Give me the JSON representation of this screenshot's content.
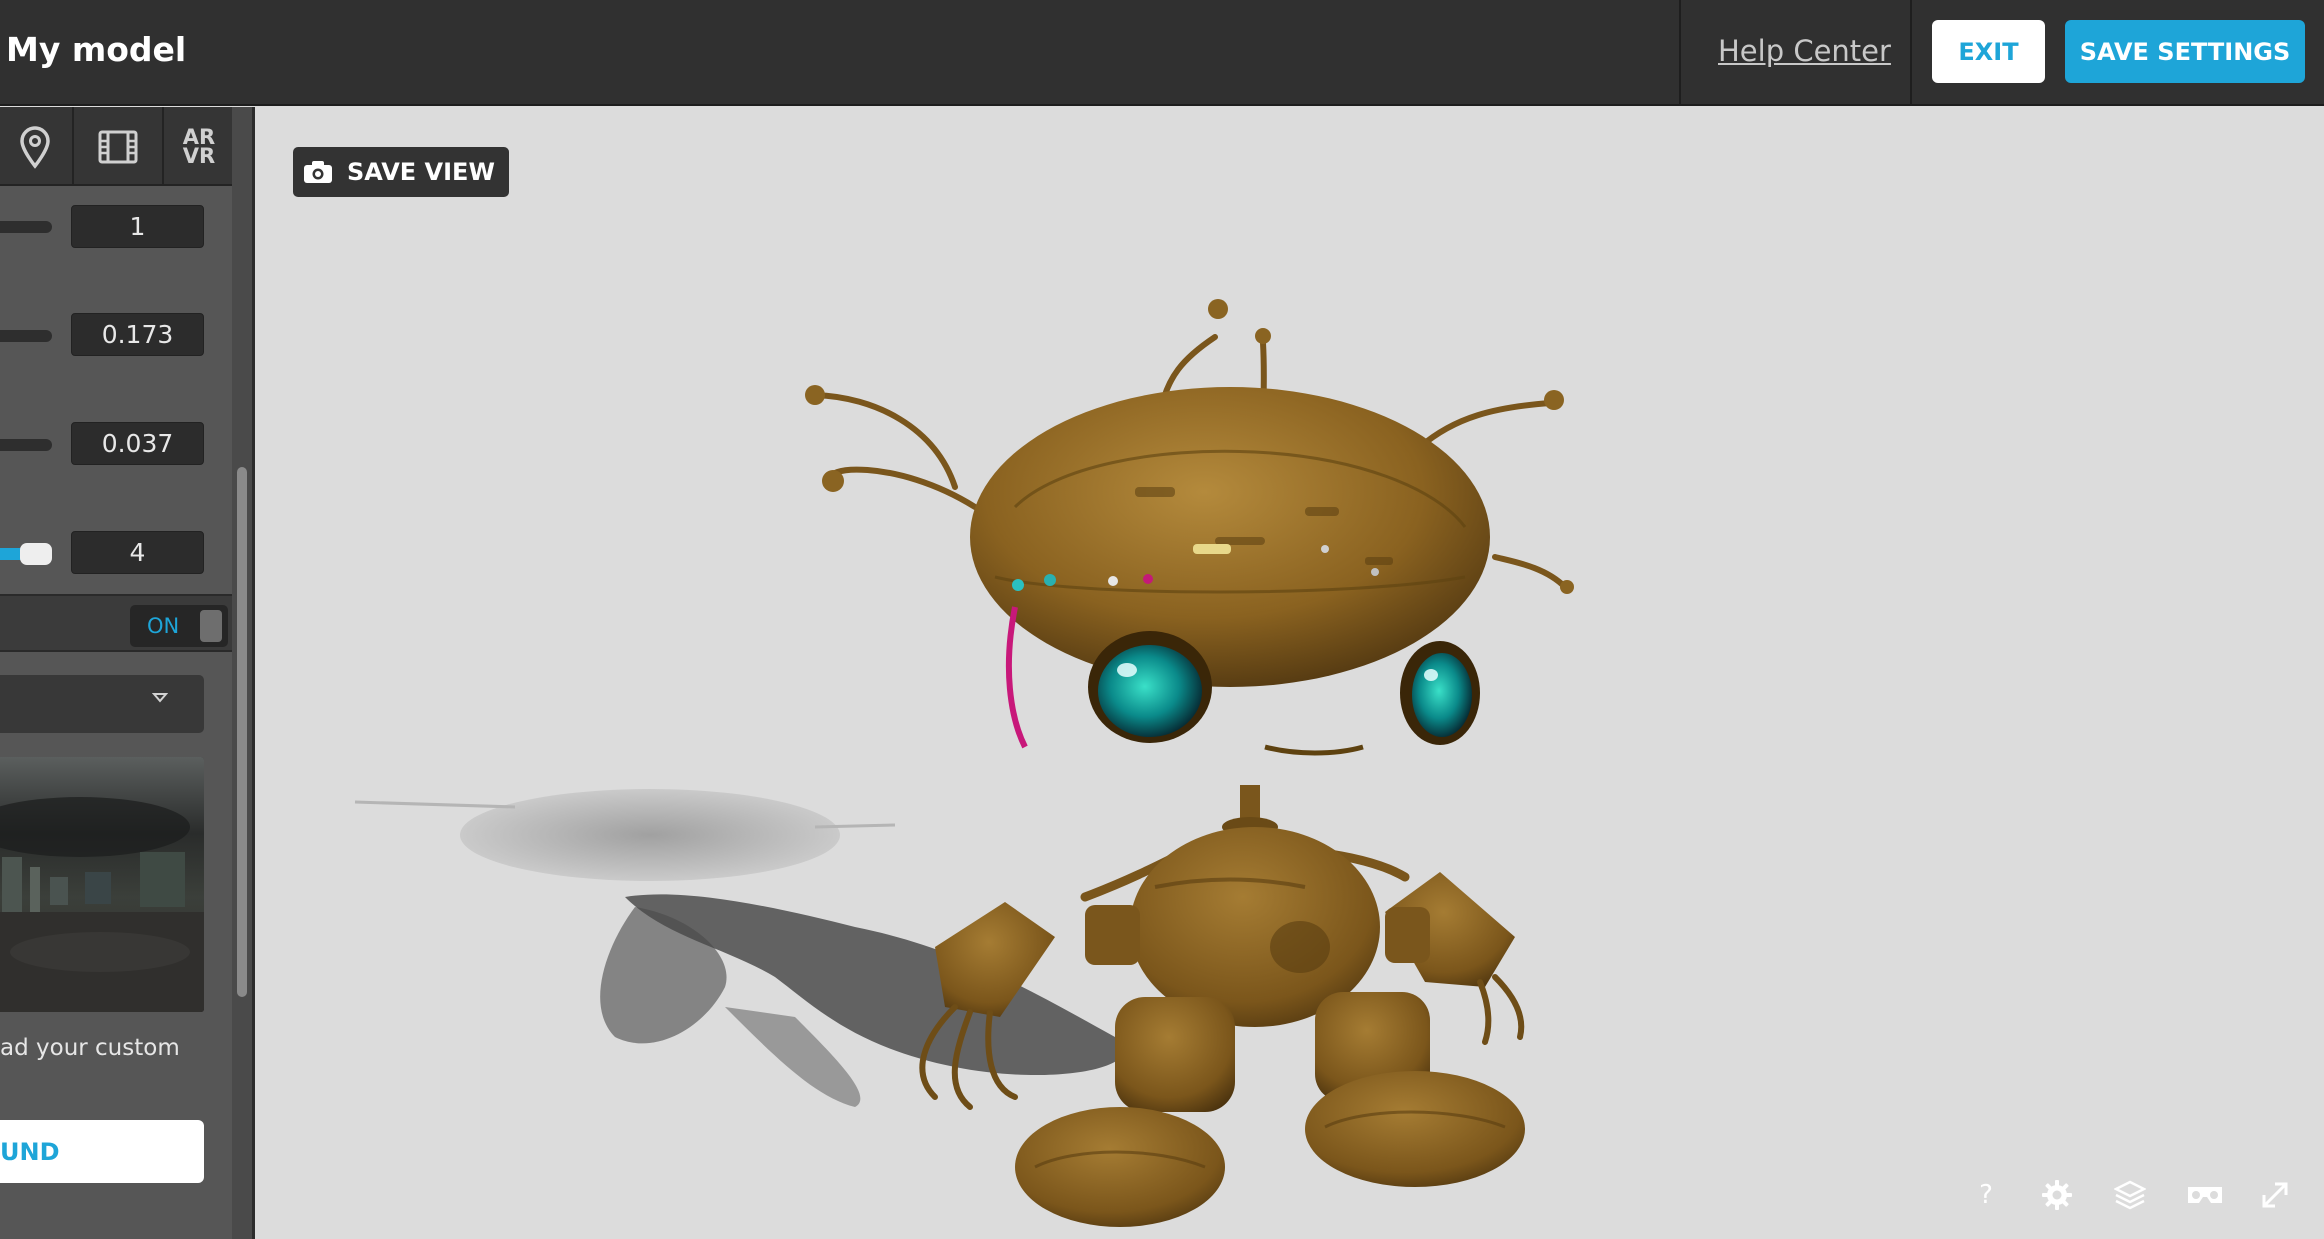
{
  "header": {
    "title": "My model",
    "help_label": "Help Center",
    "exit_label": "EXIT",
    "save_label": "SAVE SETTINGS"
  },
  "panel": {
    "tabs": [
      {
        "icon": "map-pin-icon"
      },
      {
        "icon": "film-icon"
      },
      {
        "label": "AR\nVR",
        "icon": "ar-vr-icon"
      }
    ],
    "sliders": [
      {
        "value": "1"
      },
      {
        "value": "0.173"
      },
      {
        "value": "0.037"
      },
      {
        "value": "4",
        "fill": 1.0
      }
    ],
    "toggle": {
      "label": "ON",
      "state": "on"
    },
    "dropdown": {
      "icon": "dropdown-arrow-icon"
    },
    "hint_text": "ad your custom",
    "background_button": "UND"
  },
  "viewport": {
    "save_view_label": "SAVE VIEW",
    "controls": [
      "help-icon",
      "settings-icon",
      "layers-icon",
      "vr-headset-icon",
      "fullscreen-icon"
    ]
  },
  "colors": {
    "accent": "#1ea5d8",
    "header_bg": "#303030",
    "panel_bg": "#565656",
    "viewport_bg": "#dcdcdc",
    "model": "#8a6220"
  }
}
